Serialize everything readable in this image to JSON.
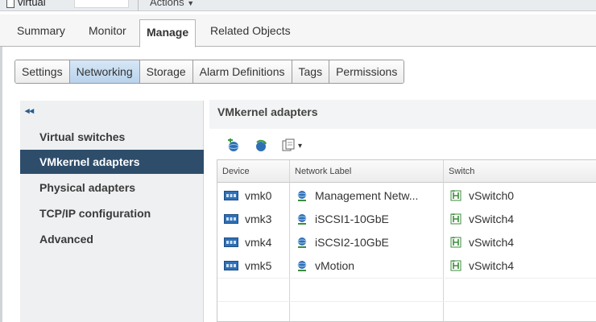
{
  "header": {
    "vm_name": "virtual",
    "actions_label": "Actions",
    "actions_caret": "▼"
  },
  "main_tabs": [
    {
      "label": "Summary"
    },
    {
      "label": "Monitor"
    },
    {
      "label": "Manage",
      "active": true
    },
    {
      "label": "Related Objects"
    }
  ],
  "sub_tabs": [
    {
      "label": "Settings"
    },
    {
      "label": "Networking",
      "active": true
    },
    {
      "label": "Storage"
    },
    {
      "label": "Alarm Definitions"
    },
    {
      "label": "Tags"
    },
    {
      "label": "Permissions"
    }
  ],
  "nav": {
    "collapse": "◂◂",
    "items": [
      {
        "label": "Virtual switches"
      },
      {
        "label": "VMkernel adapters",
        "active": true
      },
      {
        "label": "Physical adapters"
      },
      {
        "label": "TCP/IP configuration"
      },
      {
        "label": "Advanced"
      }
    ]
  },
  "content": {
    "title": "VMkernel adapters",
    "toolbar": {
      "add_icon": "add-networking-icon",
      "refresh_icon": "refresh-icon",
      "edit_icon": "edit-settings-icon",
      "dropdown_caret": "▾"
    }
  },
  "table": {
    "columns": [
      "Device",
      "Network Label",
      "Switch"
    ],
    "rows": [
      {
        "device": "vmk0",
        "network_label": "Management Netw...",
        "switch": "vSwitch0"
      },
      {
        "device": "vmk3",
        "network_label": "iSCSI1-10GbE",
        "switch": "vSwitch4"
      },
      {
        "device": "vmk4",
        "network_label": "iSCSI2-10GbE",
        "switch": "vSwitch4"
      },
      {
        "device": "vmk5",
        "network_label": "vMotion",
        "switch": "vSwitch4"
      }
    ]
  },
  "colors": {
    "nav_active": "#2e4d6b",
    "subtab_active": "#c5dcf1",
    "icon_blue": "#2f6fb5",
    "icon_green": "#3c8c3c"
  }
}
